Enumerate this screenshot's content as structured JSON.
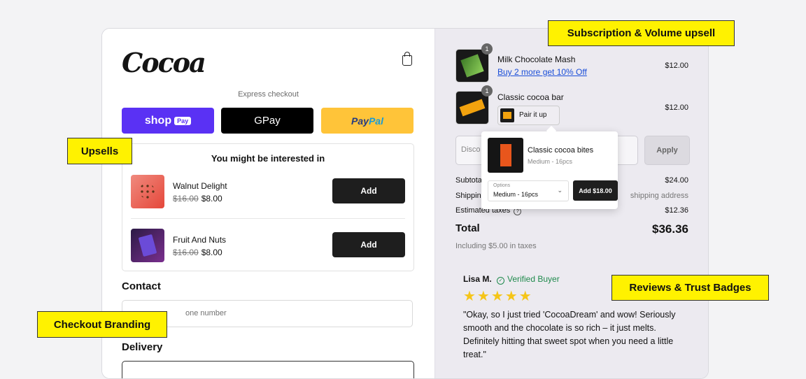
{
  "brand": {
    "logo_text": "Cocoa"
  },
  "checkout": {
    "express_label": "Express checkout",
    "shop_pay": {
      "shop": "shop",
      "pay": "Pay"
    },
    "gpay": {
      "g": "G",
      "pay": " Pay"
    },
    "paypal": {
      "pay": "Pay",
      "pal": "Pal"
    }
  },
  "upsell": {
    "title": "You might be interested in",
    "items": [
      {
        "name": "Walnut Delight",
        "old_price": "$16.00",
        "price": "$8.00",
        "button": "Add"
      },
      {
        "name": "Fruit And Nuts",
        "old_price": "$16.00",
        "price": "$8.00",
        "button": "Add"
      }
    ]
  },
  "contact": {
    "heading": "Contact",
    "phone_placeholder": "one number"
  },
  "delivery": {
    "heading": "Delivery"
  },
  "cart": {
    "items": [
      {
        "name": "Milk Chocolate Mash",
        "qty": "1",
        "price": "$12.00",
        "promo": "Buy 2 more get 10% Off"
      },
      {
        "name": "Classic cocoa bar",
        "qty": "1",
        "price": "$12.00",
        "pair_label": "Pair it up"
      }
    ],
    "discount_placeholder": "Disco",
    "apply_label": "Apply",
    "popup": {
      "name": "Classic cocoa bites",
      "variant": "Medium - 16pcs",
      "options_label": "Options",
      "option_value": "Medium - 16pcs",
      "add_label": "Add $18.00"
    },
    "summary": {
      "subtotal_label": "Subtota",
      "subtotal_value": "$24.00",
      "shipping_label": "Shippin",
      "shipping_value": "shipping address",
      "taxes_label": "Estimated taxes",
      "taxes_value": "$12.36",
      "total_label": "Total",
      "total_value": "$36.36",
      "including": "Including $5.00 in taxes"
    }
  },
  "review": {
    "name": "Lisa M.",
    "badge": "Verified Buyer",
    "stars": "★★★★★",
    "text": "\"Okay, so I just tried 'CocoaDream' and wow! Seriously smooth and the chocolate is so rich – it just melts. Definitely hitting that sweet spot when you need a little treat.\""
  },
  "annotations": {
    "subscription": "Subscription & Volume upsell",
    "upsells": "Upsells",
    "reviews": "Reviews & Trust Badges",
    "branding": "Checkout Branding"
  },
  "colors": {
    "shop_pay": "#5a31f4",
    "paypal": "#ffc439",
    "tag": "#fff200",
    "link": "#1a4ed8",
    "verified": "#1f8a4c"
  }
}
